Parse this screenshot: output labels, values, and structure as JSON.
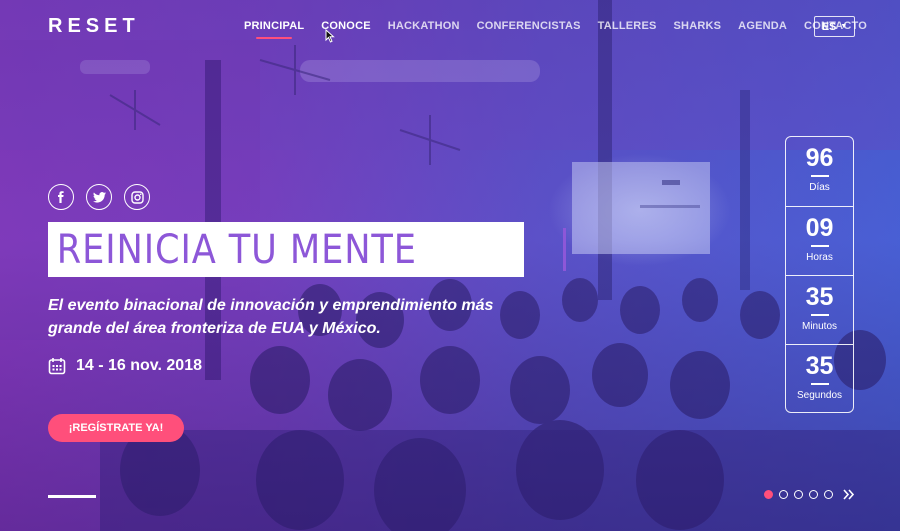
{
  "brand": {
    "logo_text": "RESET"
  },
  "nav": {
    "items": [
      {
        "label": "PRINCIPAL",
        "active": true
      },
      {
        "label": "CONOCE"
      },
      {
        "label": "HACKATHON"
      },
      {
        "label": "CONFERENCISTAS"
      },
      {
        "label": "TALLERES"
      },
      {
        "label": "SHARKS"
      },
      {
        "label": "AGENDA"
      },
      {
        "label": "CONTACTO"
      }
    ],
    "language": "ES"
  },
  "social": {
    "icons": [
      "facebook-icon",
      "twitter-icon",
      "instagram-icon"
    ]
  },
  "hero": {
    "title": "REINICIA TU MENTE",
    "subtitle_line1": "El evento binacional de innovación y emprendimiento más",
    "subtitle_line2": "grande del área fronteriza de EUA y México.",
    "date": "14 - 16 nov. 2018",
    "cta_label": "¡REGÍSTRATE YA!"
  },
  "countdown": [
    {
      "value": "96",
      "unit": "Días"
    },
    {
      "value": "09",
      "unit": "Horas"
    },
    {
      "value": "35",
      "unit": "Minutos"
    },
    {
      "value": "35",
      "unit": "Segundos"
    }
  ],
  "slider": {
    "total_slides": 5,
    "current_slide": 1
  },
  "colors": {
    "accent": "#ff4f7b",
    "title_text": "#8d57d8",
    "gradient_left": "#8a3cc4",
    "gradient_right": "#4b64dc"
  }
}
